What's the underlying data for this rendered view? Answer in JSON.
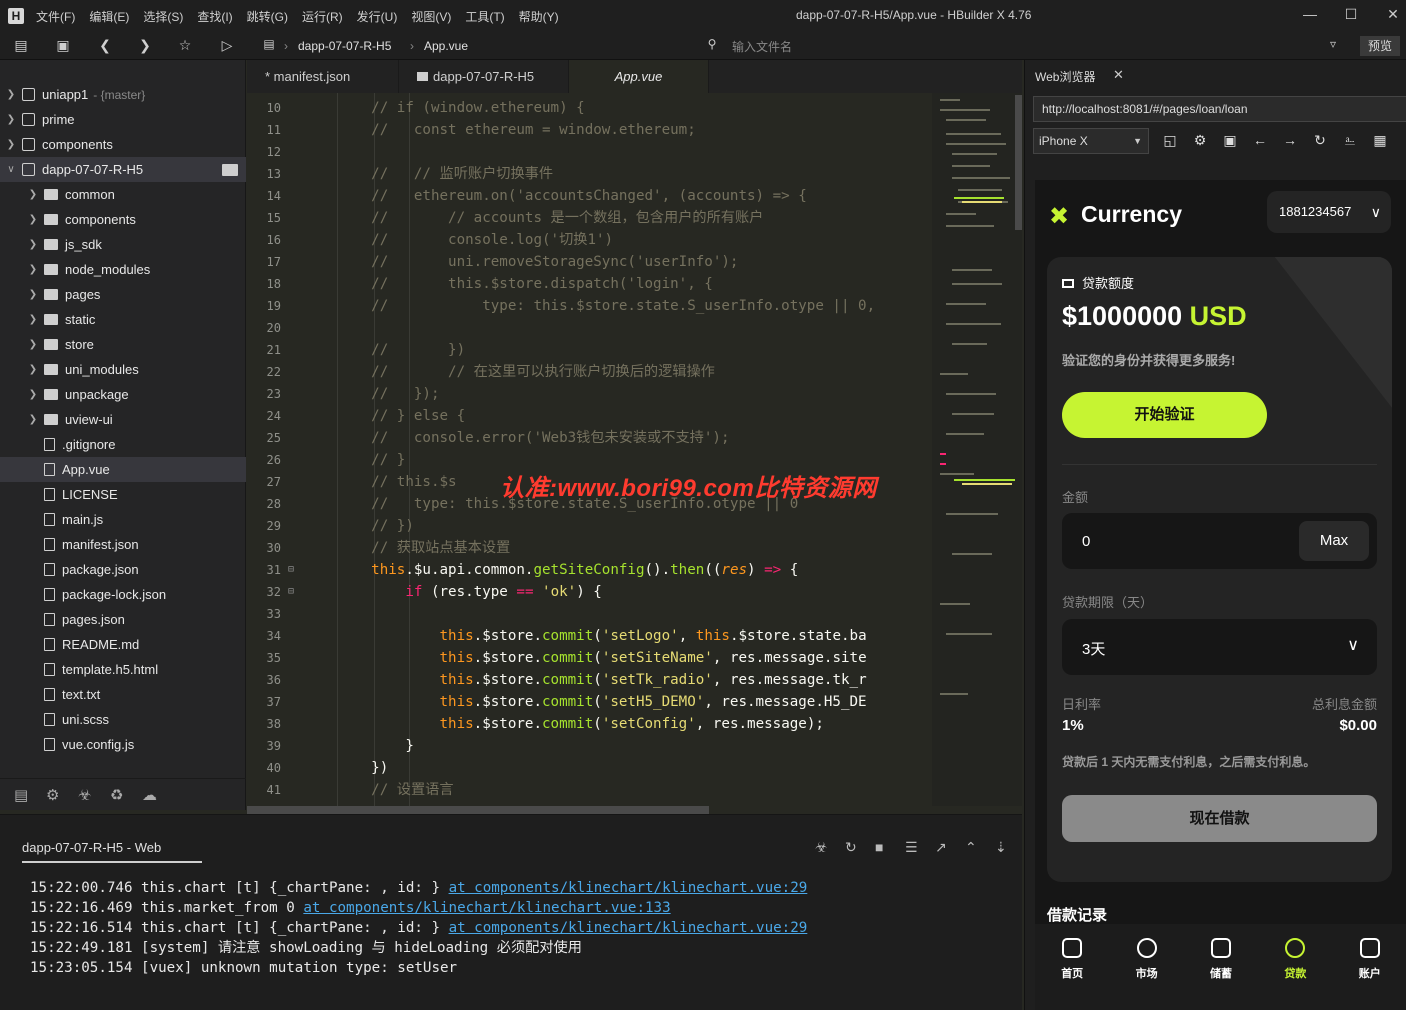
{
  "window": {
    "title": "dapp-07-07-R-H5/App.vue - HBuilder X 4.76",
    "menu": [
      "文件(F)",
      "编辑(E)",
      "选择(S)",
      "查找(I)",
      "跳转(G)",
      "运行(R)",
      "发行(U)",
      "视图(V)",
      "工具(T)",
      "帮助(Y)"
    ]
  },
  "toolbar": {
    "breadcrumb_project": "dapp-07-07-R-H5",
    "breadcrumb_file": "App.vue",
    "file_input_placeholder": "输入文件名",
    "preview_label": "预览"
  },
  "sidebar": {
    "projects": [
      {
        "name": "uniapp1",
        "branch": "- {master}"
      },
      {
        "name": "prime",
        "branch": ""
      },
      {
        "name": "components",
        "branch": ""
      },
      {
        "name": "dapp-07-07-R-H5",
        "branch": ""
      }
    ],
    "folders": [
      "common",
      "components",
      "js_sdk",
      "node_modules",
      "pages",
      "static",
      "store",
      "uni_modules",
      "unpackage",
      "uview-ui"
    ],
    "files": [
      ".gitignore",
      "App.vue",
      "LICENSE",
      "main.js",
      "manifest.json",
      "package.json",
      "package-lock.json",
      "pages.json",
      "README.md",
      "template.h5.html",
      "text.txt",
      "uni.scss",
      "vue.config.js"
    ]
  },
  "tabs": [
    "* manifest.json",
    "dapp-07-07-R-H5",
    "App.vue"
  ],
  "editor": {
    "lines": [
      {
        "n": "10",
        "text": "    // if (window.ethereum) {"
      },
      {
        "n": "11",
        "text": "    //   const ethereum = window.ethereum;"
      },
      {
        "n": "12",
        "text": ""
      },
      {
        "n": "13",
        "text": "    //   // 监听账户切换事件"
      },
      {
        "n": "14",
        "text": "    //   ethereum.on('accountsChanged', (accounts) => {"
      },
      {
        "n": "15",
        "text": "    //       // accounts 是一个数组，包含用户的所有账户"
      },
      {
        "n": "16",
        "text": "    //       console.log('切换1')"
      },
      {
        "n": "17",
        "text": "    //       uni.removeStorageSync('userInfo');"
      },
      {
        "n": "18",
        "text": "    //       this.$store.dispatch('login', {"
      },
      {
        "n": "19",
        "text": "    //           type: this.$store.state.S_userInfo.otype || 0,"
      },
      {
        "n": "20",
        "text": ""
      },
      {
        "n": "21",
        "text": "    //       })"
      },
      {
        "n": "22",
        "text": "    //       // 在这里可以执行账户切换后的逻辑操作"
      },
      {
        "n": "23",
        "text": "    //   });"
      },
      {
        "n": "24",
        "text": "    // } else {"
      },
      {
        "n": "25",
        "text": "    //   console.error('Web3钱包未安装或不支持');"
      },
      {
        "n": "26",
        "text": "    // }"
      },
      {
        "n": "27",
        "text": "    // this.$s"
      },
      {
        "n": "28",
        "text": "    //   type: this.$store.state.S_userInfo.otype || 0"
      },
      {
        "n": "29",
        "text": "    // })"
      },
      {
        "n": "30",
        "text": "    // 获取站点基本设置"
      },
      {
        "n": "31",
        "text": "    this.$u.api.common.getSiteConfig().then((res) => {"
      },
      {
        "n": "32",
        "text": "        if (res.type == 'ok') {"
      },
      {
        "n": "33",
        "text": ""
      },
      {
        "n": "34",
        "text": "            this.$store.commit('setLogo', this.$store.state.ba"
      },
      {
        "n": "35",
        "text": "            this.$store.commit('setSiteName', res.message.site"
      },
      {
        "n": "36",
        "text": "            this.$store.commit('setTk_radio', res.message.tk_r"
      },
      {
        "n": "37",
        "text": "            this.$store.commit('setH5_DEMO', res.message.H5_DE"
      },
      {
        "n": "38",
        "text": "            this.$store.commit('setConfig', res.message);"
      },
      {
        "n": "39",
        "text": "        }"
      },
      {
        "n": "40",
        "text": "    })"
      },
      {
        "n": "41",
        "text": "    // 设置语言"
      }
    ],
    "watermark": "认准:www.bori99.com比特资源网"
  },
  "console": {
    "title": "dapp-07-07-R-H5 - Web",
    "logs": [
      {
        "time": "15:22:00.746",
        "msg": "this.chart [t] {_chartPane: , id: }",
        "link": "at components/klinechart/klinechart.vue:29"
      },
      {
        "time": "15:22:16.469",
        "msg": "this.market_from 0",
        "link": "at components/klinechart/klinechart.vue:133"
      },
      {
        "time": "15:22:16.514",
        "msg": "this.chart [t] {_chartPane: , id: }",
        "link": "at components/klinechart/klinechart.vue:29"
      },
      {
        "time": "15:22:49.181",
        "msg": "[system] 请注意 showLoading 与 hideLoading 必须配对使用",
        "link": ""
      },
      {
        "time": "15:23:05.154",
        "msg": "[vuex] unknown mutation type: setUser",
        "link": ""
      }
    ]
  },
  "browser": {
    "tab_label": "Web浏览器",
    "url": "http://localhost:8081/#/pages/loan/loan",
    "device": "iPhone X"
  },
  "app": {
    "brand": "Currency",
    "account": "1881234567",
    "loan_limit_label": "贷款额度",
    "loan_limit_value": "$1000000",
    "loan_limit_currency": "USD",
    "verify_hint": "验证您的身份并获得更多服务!",
    "verify_button": "开始验证",
    "amount_label": "金额",
    "amount_value": "0",
    "max_button": "Max",
    "term_label": "贷款期限（天）",
    "term_value": "3天",
    "daily_rate_label": "日利率",
    "daily_rate_value": "1%",
    "total_interest_label": "总利息金额",
    "total_interest_value": "$0.00",
    "interest_note": "贷款后 1 天内无需支付利息，之后需支付利息。",
    "borrow_button": "现在借款",
    "records_title": "借款记录",
    "nav": [
      "首页",
      "市场",
      "储蓄",
      "贷款",
      "账户"
    ],
    "accent_color": "#c6f432"
  }
}
